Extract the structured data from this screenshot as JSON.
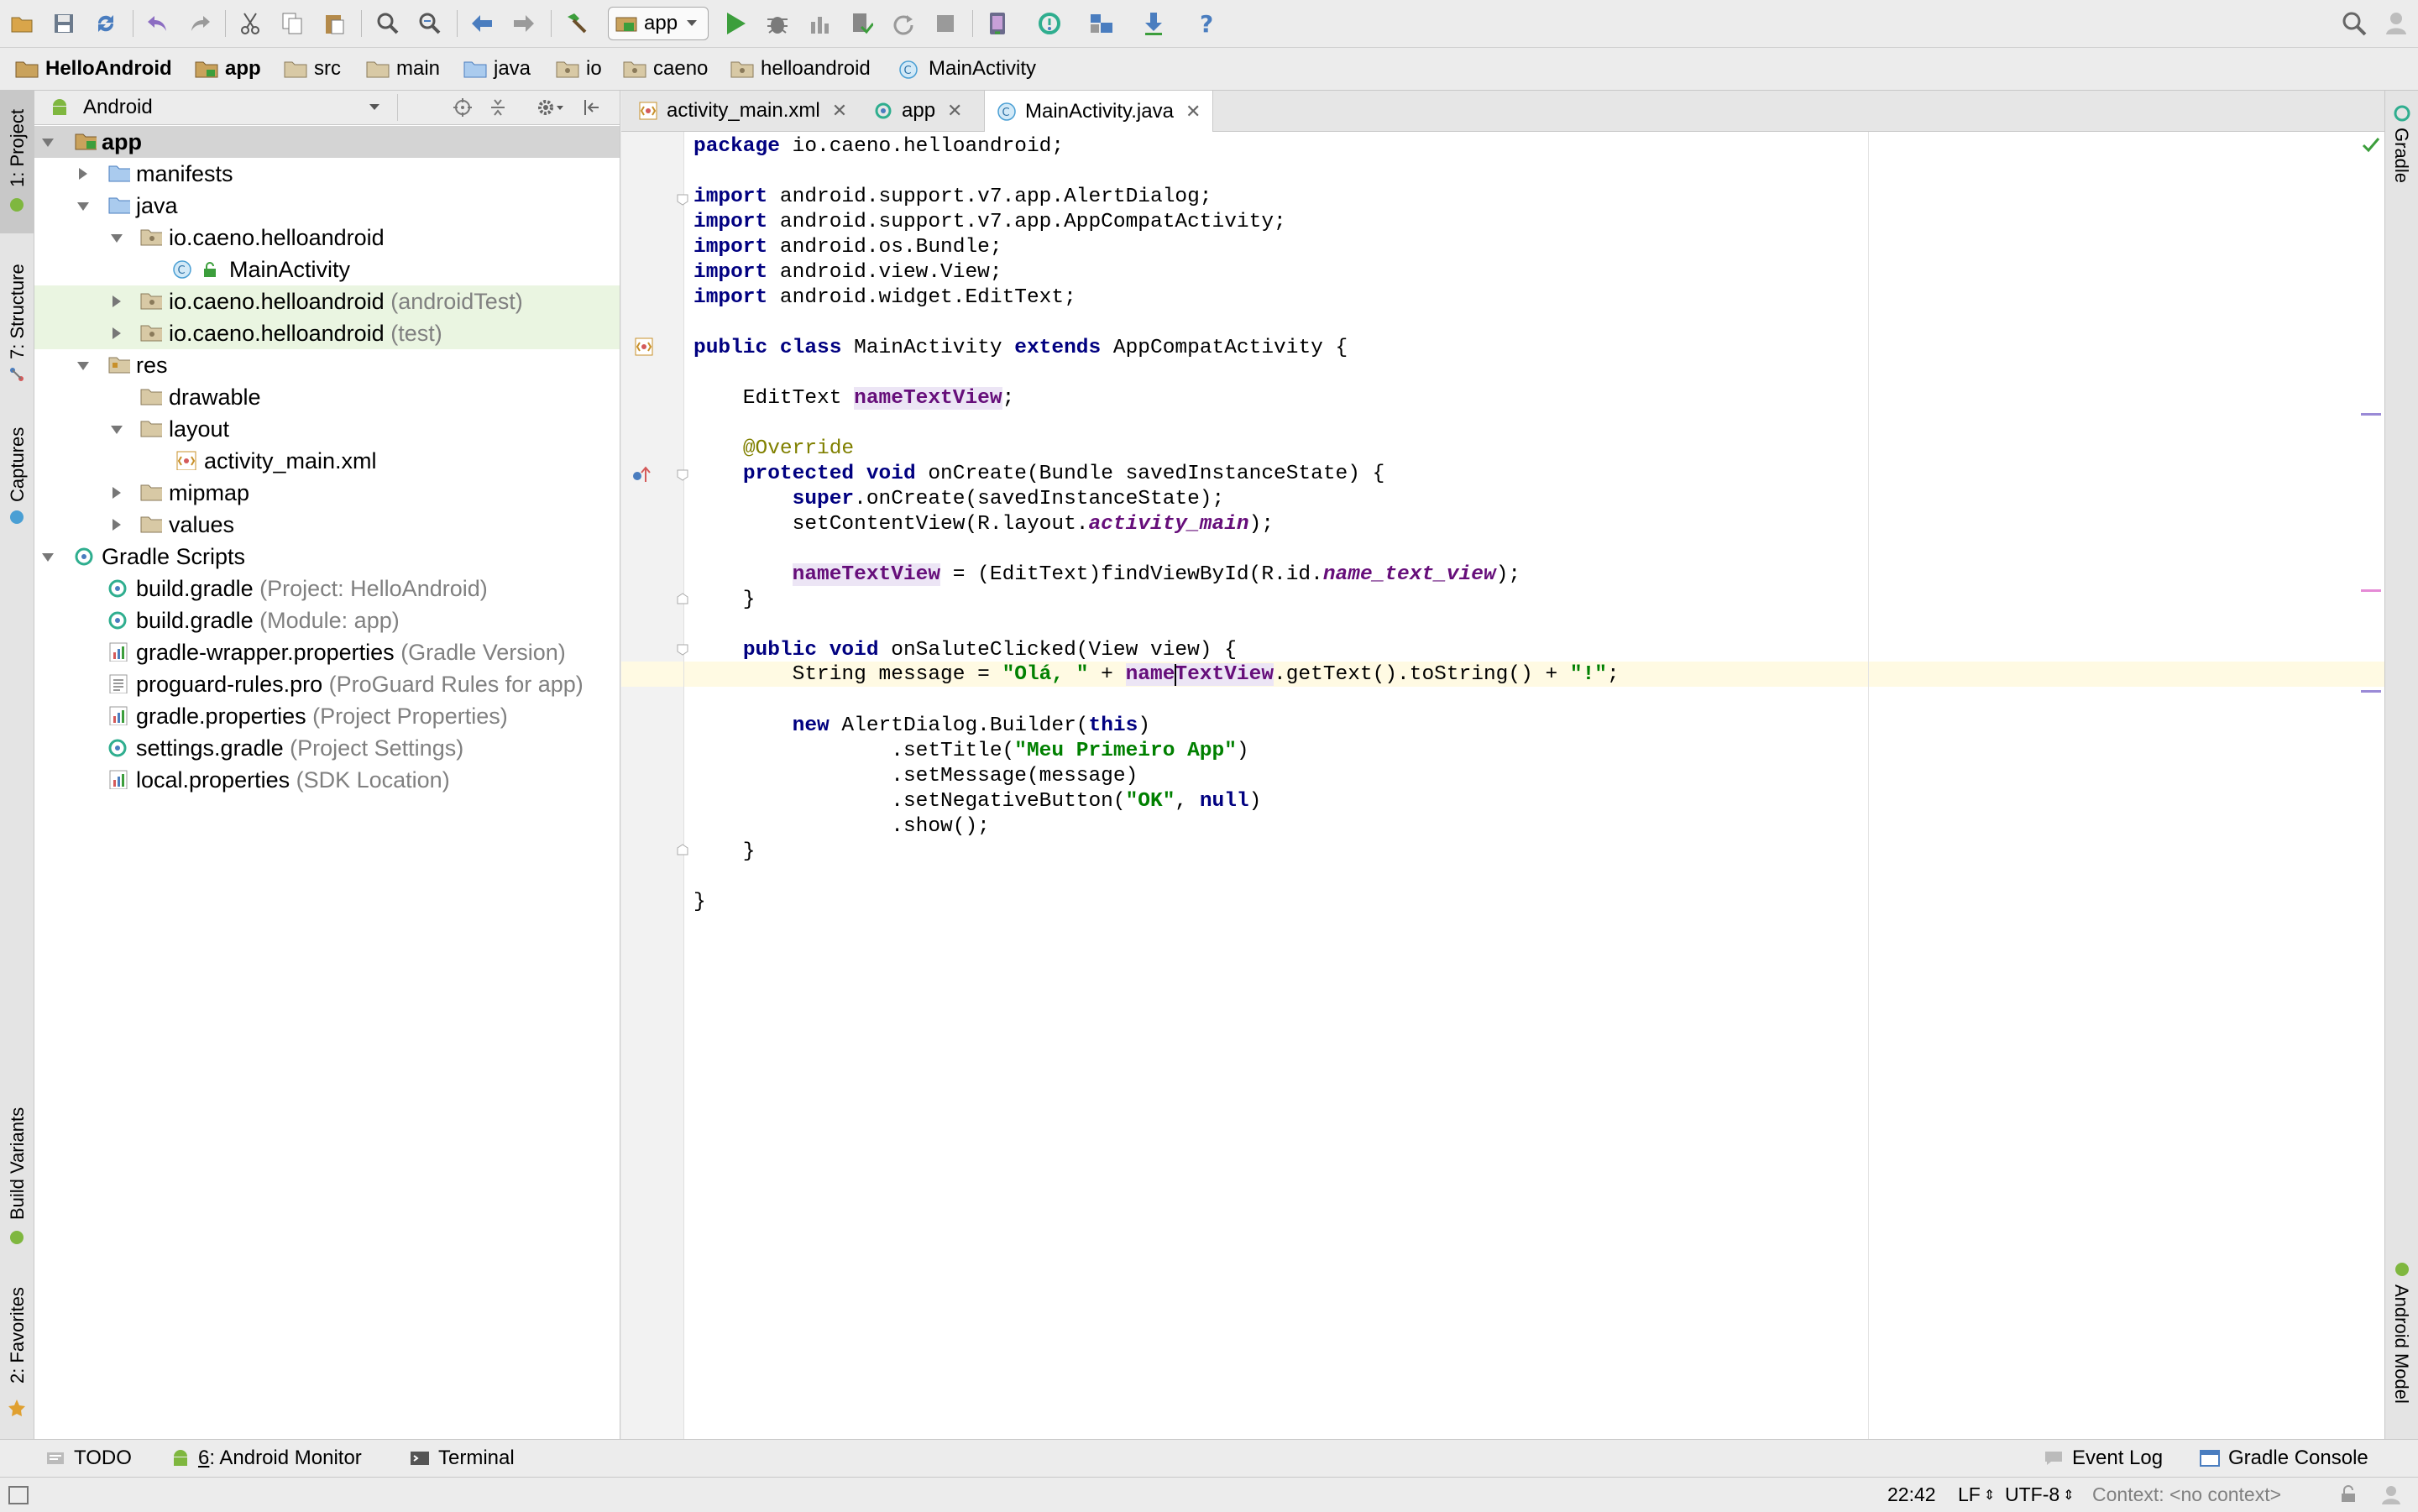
{
  "toolbar": {
    "run_config": "app",
    "icons": [
      "open-icon",
      "save-icon",
      "sync-icon",
      "undo-icon",
      "redo-icon",
      "cut-icon",
      "copy-icon",
      "paste-icon",
      "find-icon",
      "replace-icon",
      "back-icon",
      "forward-icon",
      "make-icon",
      "run-icon",
      "debug-icon",
      "attach-icon",
      "apply-changes-icon",
      "rerun-icon",
      "stop-icon",
      "avd-manager-icon",
      "sync-gradle-icon",
      "project-structure-icon",
      "sdk-manager-icon",
      "help-icon",
      "search-everywhere-icon",
      "user-icon"
    ]
  },
  "breadcrumbs": [
    "HelloAndroid",
    "app",
    "src",
    "main",
    "java",
    "io",
    "caeno",
    "helloandroid",
    "MainActivity"
  ],
  "left_stripe": {
    "project": "1: Project",
    "structure": "7: Structure",
    "captures": "Captures",
    "build_variants": "Build Variants",
    "favorites": "2: Favorites"
  },
  "right_stripe": {
    "gradle": "Gradle",
    "android_model": "Android Model"
  },
  "project_panel": {
    "view_mode": "Android",
    "tree": [
      {
        "label": "app",
        "hint": ""
      },
      {
        "label": "manifests",
        "hint": ""
      },
      {
        "label": "java",
        "hint": ""
      },
      {
        "label": "io.caeno.helloandroid",
        "hint": ""
      },
      {
        "label": "MainActivity",
        "hint": ""
      },
      {
        "label": "io.caeno.helloandroid",
        "hint": "(androidTest)"
      },
      {
        "label": "io.caeno.helloandroid",
        "hint": "(test)"
      },
      {
        "label": "res",
        "hint": ""
      },
      {
        "label": "drawable",
        "hint": ""
      },
      {
        "label": "layout",
        "hint": ""
      },
      {
        "label": "activity_main.xml",
        "hint": ""
      },
      {
        "label": "mipmap",
        "hint": ""
      },
      {
        "label": "values",
        "hint": ""
      },
      {
        "label": "Gradle Scripts",
        "hint": ""
      },
      {
        "label": "build.gradle",
        "hint": "(Project: HelloAndroid)"
      },
      {
        "label": "build.gradle",
        "hint": "(Module: app)"
      },
      {
        "label": "gradle-wrapper.properties",
        "hint": "(Gradle Version)"
      },
      {
        "label": "proguard-rules.pro",
        "hint": "(ProGuard Rules for app)"
      },
      {
        "label": "gradle.properties",
        "hint": "(Project Properties)"
      },
      {
        "label": "settings.gradle",
        "hint": "(Project Settings)"
      },
      {
        "label": "local.properties",
        "hint": "(SDK Location)"
      }
    ]
  },
  "editor_tabs": [
    "activity_main.xml",
    "app",
    "MainActivity.java"
  ],
  "code": {
    "l1": [
      "package",
      " io.caeno.helloandroid;"
    ],
    "l3": [
      "import",
      " android.support.v7.app.AlertDialog;"
    ],
    "l4": [
      "import",
      " android.support.v7.app.AppCompatActivity;"
    ],
    "l5": [
      "import",
      " android.os.Bundle;"
    ],
    "l6": [
      "import",
      " android.view.View;"
    ],
    "l7": [
      "import",
      " android.widget.EditText;"
    ],
    "l9": [
      "public class",
      " MainActivity ",
      "extends",
      " AppCompatActivity {"
    ],
    "l11": [
      "    EditText ",
      "nameTextView",
      ";"
    ],
    "l13": [
      "    ",
      "@Override"
    ],
    "l14": [
      "    ",
      "protected void",
      " onCreate(Bundle savedInstanceState) {"
    ],
    "l15": [
      "        ",
      "super",
      ".onCreate(savedInstanceState);"
    ],
    "l16": [
      "        setContentView(R.layout.",
      "activity_main",
      ");"
    ],
    "l18": [
      "        ",
      "nameTextView",
      " = (EditText)findViewById(R.id.",
      "name_text_view",
      ");"
    ],
    "l19": [
      "    }"
    ],
    "l21": [
      "    ",
      "public void",
      " onSaluteClicked(View view) {"
    ],
    "l22": [
      "        String message = ",
      "\"Olá, \"",
      " + ",
      "nameTextView",
      ".getText().toString() + ",
      "\"!\"",
      ";"
    ],
    "l24": [
      "        ",
      "new",
      " AlertDialog.Builder(",
      "this",
      ")"
    ],
    "l25": [
      "                .setTitle(",
      "\"Meu Primeiro App\"",
      ")"
    ],
    "l26": [
      "                .setMessage(message)"
    ],
    "l27": [
      "                .setNegativeButton(",
      "\"OK\"",
      ", ",
      "null",
      ")"
    ],
    "l28": [
      "                .show();"
    ],
    "l29": [
      "    }"
    ],
    "l31": [
      "}"
    ]
  },
  "bottom_tabs": {
    "todo": "TODO",
    "monitor_num": "6",
    "monitor": ": Android Monitor",
    "terminal": "Terminal",
    "event_log": "Event Log",
    "gradle_console": "Gradle Console"
  },
  "status": {
    "position": "22:42",
    "line_sep": "LF",
    "encoding": "UTF-8",
    "context": "Context: <no context>"
  },
  "colors": {
    "keyword": "#000080",
    "string": "#008000",
    "field": "#660e7a",
    "annotation": "#808000",
    "run_green": "#3c9e3c"
  }
}
